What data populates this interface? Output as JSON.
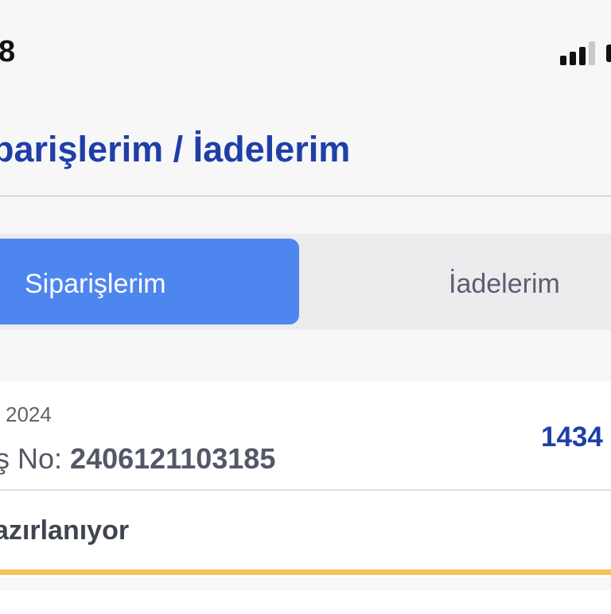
{
  "status_bar": {
    "time": "8"
  },
  "header": {
    "title": "parişlerim / İadelerim"
  },
  "tabs": [
    {
      "label": "Siparişlerim",
      "active": true
    },
    {
      "label": "İadelerim",
      "active": false
    }
  ],
  "order": {
    "date": "2024",
    "order_no_label": "ş No:",
    "order_no_value": "240612110318​5",
    "amount": "1434",
    "status": "azırlanıyor",
    "progress_fraction": 1.0
  },
  "colors": {
    "title": "#1f3fa7",
    "active_tab": "#4e86f0",
    "progress": "#f2c25b"
  }
}
